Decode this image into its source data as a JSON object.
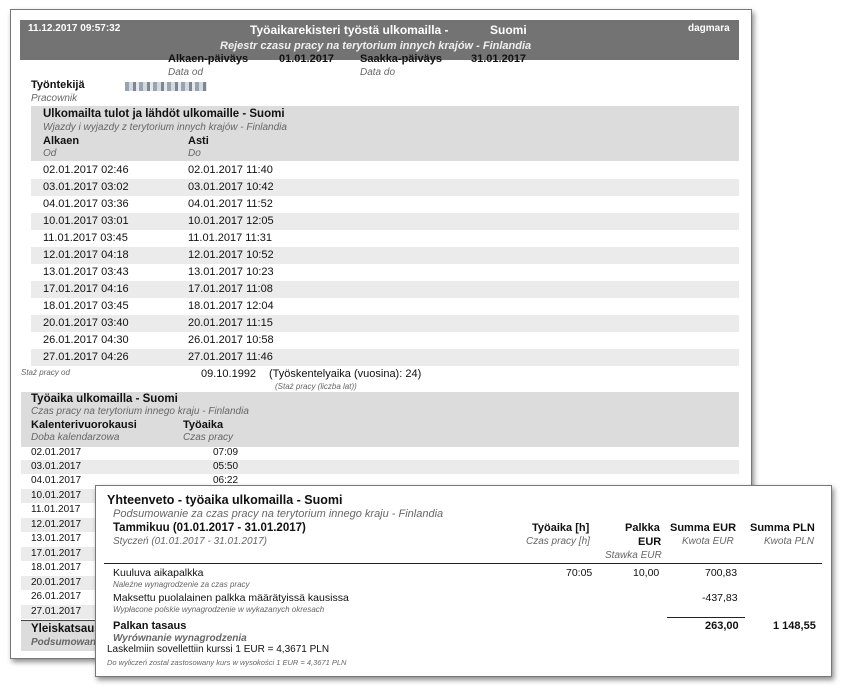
{
  "report": {
    "header": {
      "timestamp": "11.12.2017  09:57:32",
      "title": "Työaikarekisteri työstä ulkomailla -",
      "country": "Suomi",
      "user": "dagmara",
      "subtitle": "Rejestr czasu pracy na terytorium innych krajów - Finlandia"
    },
    "period": {
      "from_label": "Alkaen-päiväys",
      "from_sub": "Data od",
      "from_value": "01.01.2017",
      "to_label": "Saakka-päiväys",
      "to_sub": "Data do",
      "to_value": "31.01.2017"
    },
    "employee": {
      "label": "Työntekijä",
      "sub": "Pracownik"
    },
    "trips": {
      "title": "Ulkomailta tulot ja lähdöt ulkomaille - Suomi",
      "subtitle": "Wjazdy i wyjazdy z terytorium innych krajów - Finlandia",
      "col_from": "Alkaen",
      "col_from_sub": "Od",
      "col_to": "Asti",
      "col_to_sub": "Do",
      "rows": [
        [
          "02.01.2017  02:46",
          "02.01.2017  11:40"
        ],
        [
          "03.01.2017  03:02",
          "03.01.2017  10:42"
        ],
        [
          "04.01.2017  03:36",
          "04.01.2017  11:52"
        ],
        [
          "10.01.2017  03:01",
          "10.01.2017  12:05"
        ],
        [
          "11.01.2017  03:45",
          "11.01.2017  11:31"
        ],
        [
          "12.01.2017  04:18",
          "12.01.2017  10:52"
        ],
        [
          "13.01.2017  03:43",
          "13.01.2017  10:23"
        ],
        [
          "17.01.2017  04:16",
          "17.01.2017  11:08"
        ],
        [
          "18.01.2017  03:45",
          "18.01.2017  12:04"
        ],
        [
          "20.01.2017  03:40",
          "20.01.2017  11:15"
        ],
        [
          "26.01.2017  04:30",
          "26.01.2017  10:58"
        ],
        [
          "27.01.2017  04:26",
          "27.01.2017  11:46"
        ]
      ]
    },
    "seniority": {
      "label": "Staż pracy od",
      "date": "09.10.1992",
      "years_text": "(Työskentelyaika (vuosina): 24)",
      "years_sub": "(Staż pracy (liczba lat))"
    },
    "worktime": {
      "title": "Työaika ulkomailla - Suomi",
      "subtitle": "Czas pracy na terytorium innego kraju - Finlandia",
      "col_day": "Kalenterivuorokausi",
      "col_day_sub": "Doba kalendarzowa",
      "col_time": "Työaika",
      "col_time_sub": "Czas pracy",
      "rows": [
        [
          "02.01.2017",
          "07:09"
        ],
        [
          "03.01.2017",
          "05:50"
        ],
        [
          "04.01.2017",
          "06:22"
        ],
        [
          "10.01.2017",
          ""
        ],
        [
          "11.01.2017",
          ""
        ],
        [
          "12.01.2017",
          ""
        ],
        [
          "13.01.2017",
          ""
        ],
        [
          "17.01.2017",
          ""
        ],
        [
          "18.01.2017",
          ""
        ],
        [
          "20.01.2017",
          ""
        ],
        [
          "26.01.2017",
          ""
        ],
        [
          "27.01.2017",
          ""
        ]
      ],
      "footer_label": "Yleiskatsaus",
      "footer_sub": "Podsumowan"
    }
  },
  "summary": {
    "title": "Yhteenveto - työaika ulkomailla - Suomi",
    "subtitle": "Podsumowanie za czas pracy na terytorium innego kraju - Finlandia",
    "month_label": "Tammikuu (01.01.2017 - 31.01.2017)",
    "month_sub": "Styczeń (01.01.2017 - 31.01.2017)",
    "col_hours": "Työaika [h]",
    "col_hours_sub": "Czas pracy [h]",
    "col_wage_1": "Palkka",
    "col_wage_2": "EUR",
    "col_wage_sub": "Stawka EUR",
    "col_sum_eur": "Summa EUR",
    "col_sum_eur_sub": "Kwota EUR",
    "col_sum_pln": "Summa PLN",
    "col_sum_pln_sub": "Kwota PLN",
    "line1_label": "Kuuluva aikapalkka",
    "line1_sub": "Należne wynagrodzenie za czas pracy",
    "line1_hours": "70:05",
    "line1_rate": "10,00",
    "line1_eur": "700,83",
    "line2_label": "Maksettu puolalainen palkka määrätyissä kausissa",
    "line2_sub": "Wypłacone polskie wynagrodzenie w wykazanych okresach",
    "line2_eur": "-437,83",
    "total_label": "Palkan tasaus",
    "total_sub": "Wyrównanie wynagrodzenia",
    "total_eur": "263,00",
    "total_pln": "1 148,55",
    "rate_text": "Laskelmiin sovellettiin kurssi 1 EUR = 4,3671 PLN",
    "rate_sub": "Do wyliczeń zostal zastosowany kurs w wysokości 1 EUR = 4,3671 PLN"
  }
}
